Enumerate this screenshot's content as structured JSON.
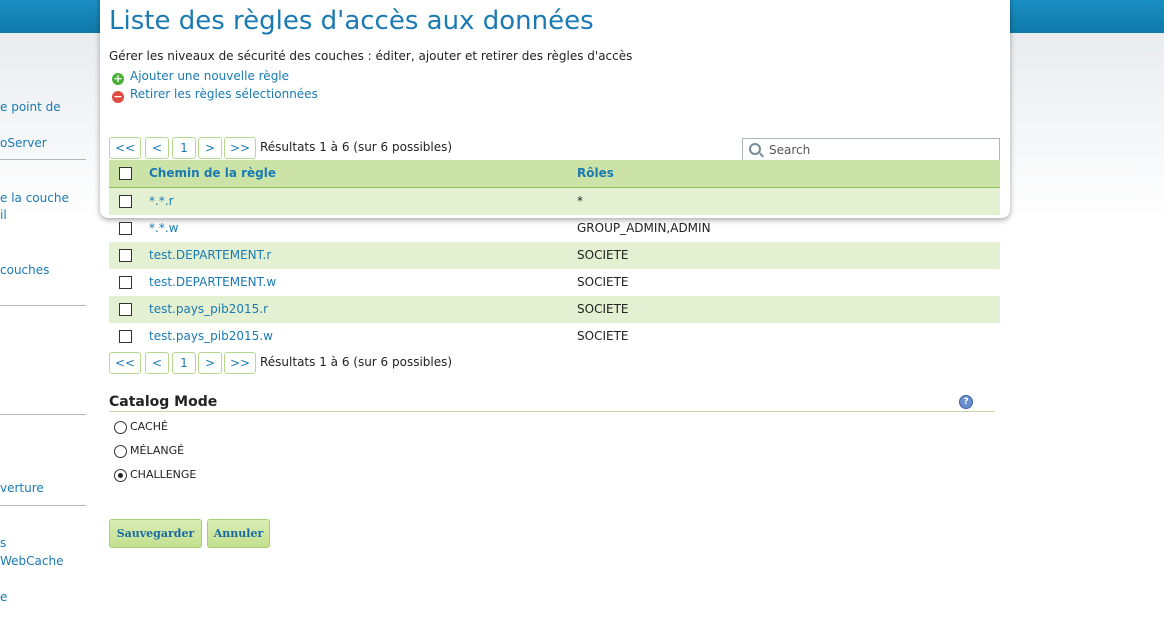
{
  "sidebar": {
    "links": [
      "e point de",
      "oServer",
      "e la couche",
      "il",
      "couches",
      "verture",
      "s",
      "WebCache",
      "e"
    ]
  },
  "page": {
    "title": "Liste des règles d'accès aux données",
    "description": "Gérer les niveaux de sécurité des couches : éditer, ajouter et retirer des règles d'accès",
    "add_rule": "Ajouter une nouvelle règle",
    "remove_rules": "Retirer les règles sélectionnées"
  },
  "pager": {
    "first": "<<",
    "prev": "<",
    "page": "1",
    "next": ">",
    "last": ">>",
    "info": "Résultats 1 à 6 (sur 6 possibles)"
  },
  "search": {
    "placeholder": "Search"
  },
  "table": {
    "headers": {
      "path": "Chemin de la règle",
      "roles": "Rôles"
    },
    "rows": [
      {
        "path": "*.*.r",
        "roles": "*"
      },
      {
        "path": "*.*.w",
        "roles": "GROUP_ADMIN,ADMIN"
      },
      {
        "path": "test.DEPARTEMENT.r",
        "roles": "SOCIETE"
      },
      {
        "path": "test.DEPARTEMENT.w",
        "roles": "SOCIETE"
      },
      {
        "path": "test.pays_pib2015.r",
        "roles": "SOCIETE"
      },
      {
        "path": "test.pays_pib2015.w",
        "roles": "SOCIETE"
      }
    ]
  },
  "catalog": {
    "title": "Catalog Mode",
    "help_icon": "question-icon",
    "options": [
      "CACHÉ",
      "MÉLANGÉ",
      "CHALLENGE"
    ],
    "selected": "CHALLENGE"
  },
  "buttons": {
    "save": "Sauvegarder",
    "cancel": "Annuler"
  },
  "colors": {
    "accent": "#1a7ab3",
    "header_green": "#cce3a7",
    "row_alt": "#e4f0d2",
    "topbar": "#1a8fc3"
  }
}
